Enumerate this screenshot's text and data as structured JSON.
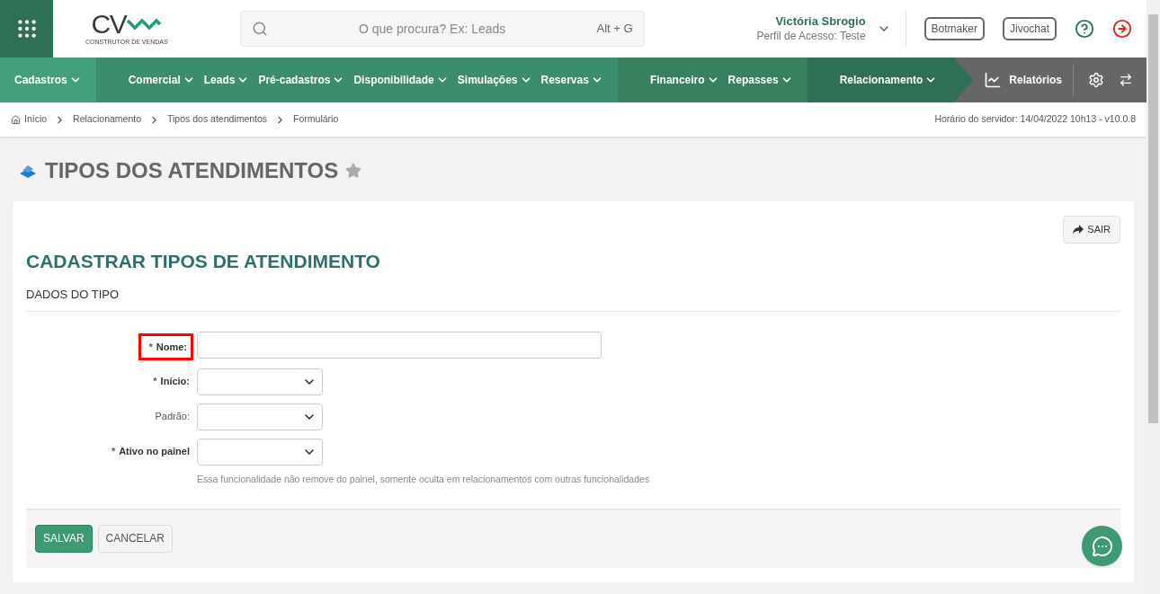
{
  "header": {
    "logo": {
      "letters": "CV",
      "tagline": "CONSTRUTOR DE VENDAS"
    },
    "search": {
      "placeholder": "O que procura? Ex: Leads",
      "shortcut": "Alt + G"
    },
    "user": {
      "name": "Victória Sbrogio",
      "profile": "Perfil de Acesso: Teste"
    },
    "buttons": [
      "Botmaker",
      "Jivochat"
    ]
  },
  "nav": {
    "segments": [
      {
        "color": "#43a07a",
        "items": [
          "Cadastros"
        ]
      },
      {
        "color": "#3d8c6b",
        "items": [
          "Comercial",
          "Leads",
          "Pré-cadastros",
          "Disponibilidade",
          "Simulações",
          "Reservas"
        ]
      },
      {
        "color": "#378060",
        "items": [
          "Financeiro",
          "Repasses"
        ]
      },
      {
        "color": "#2f6f55",
        "items": [
          "Relacionamento"
        ]
      }
    ],
    "reports": "Relatórios"
  },
  "breadcrumb": {
    "items": [
      "Início",
      "Relacionamento",
      "Tipos dos atendimentos",
      "Formulário"
    ],
    "server_time": "Horário do servidor: 14/04/2022 10h13 - v10.0.8"
  },
  "page_title": "TIPOS DOS ATENDIMENTOS",
  "card": {
    "required_mark": "*",
    "exit_button": "SAIR",
    "title": "CADASTRAR TIPOS DE ATENDIMENTO",
    "section": "DADOS DO TIPO",
    "fields": [
      {
        "kind": "text",
        "label": "Nome:",
        "required": true,
        "highlighted": true
      },
      {
        "kind": "select",
        "label": "Início:",
        "required": true,
        "highlighted": false
      },
      {
        "kind": "select",
        "label": "Padrão:",
        "required": false,
        "highlighted": false
      },
      {
        "kind": "select",
        "label": "Ativo no painel",
        "required": true,
        "highlighted": false,
        "help": "Essa funcionalidade não remove do painel, somente oculta em relacionamentos com outras funcionalidades"
      }
    ],
    "buttons": [
      {
        "label": "SALVAR",
        "kind": "primary"
      },
      {
        "label": "CANCELAR",
        "kind": "secondary"
      }
    ]
  }
}
